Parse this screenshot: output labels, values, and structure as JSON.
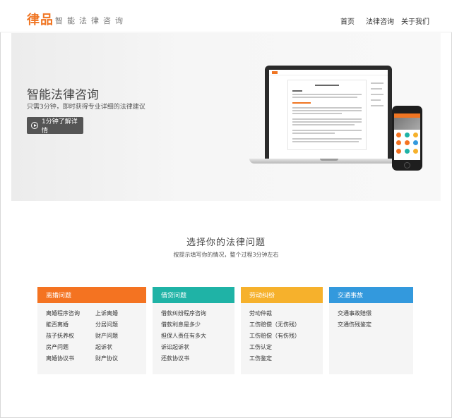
{
  "header": {
    "logo": "律品",
    "tagline": "智能法律咨询",
    "nav": [
      "首页",
      "法律咨询",
      "关于我们"
    ]
  },
  "hero": {
    "title": "智能法律咨询",
    "subtitle": "只需3分钟，即时获得专业详细的法律建议",
    "button_label": "1分钟了解详情"
  },
  "section": {
    "title": "选择你的法律问题",
    "subtitle": "按提示填写你的情况，整个过程3分钟左右"
  },
  "colors": {
    "brand": "#f07522",
    "card1": "#f47321",
    "card2": "#1fb3a6",
    "card3": "#f6b12c",
    "card4": "#3399dd"
  },
  "cards": [
    {
      "title": "离婚问题",
      "color": "#f47321",
      "items": [
        "离婚程序咨询",
        "上诉离婚",
        "能否离婚",
        "分居问题",
        "孩子抚养权",
        "财产问题",
        "房产问题",
        "起诉状",
        "离婚协议书",
        "财产协议"
      ]
    },
    {
      "title": "借贷问题",
      "color": "#1fb3a6",
      "items": [
        "借款纠纷程序咨询",
        "借款利息是多少",
        "担保人责任有多大",
        "诉讼起诉状",
        "还款协议书"
      ]
    },
    {
      "title": "劳动纠纷",
      "color": "#f6b12c",
      "items": [
        "劳动仲裁",
        "工伤赔偿（无伤残）",
        "工伤赔偿（有伤残）",
        "工伤认定",
        "工伤鉴定"
      ]
    },
    {
      "title": "交通事故",
      "color": "#3399dd",
      "items": [
        "交通事故赔偿",
        "交通伤残鉴定"
      ]
    }
  ]
}
